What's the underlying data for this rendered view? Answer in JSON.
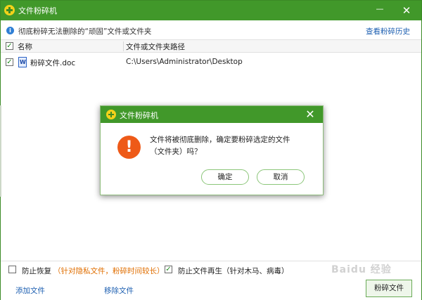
{
  "window": {
    "title": "文件粉碎机",
    "minimize_symbol": "—",
    "close_symbol": "✕"
  },
  "info": {
    "text": "彻底粉碎无法删除的“顽固”文件或文件夹",
    "history_link": "查看粉碎历史"
  },
  "table": {
    "col_name": "名称",
    "col_path": "文件或文件夹路径",
    "rows": [
      {
        "name": "粉碎文件.doc",
        "path": "C:\\Users\\Administrator\\Desktop",
        "checked": true
      }
    ]
  },
  "dialog": {
    "title": "文件粉碎机",
    "message_line1": "文件将被彻底删除，确定要粉碎选定的文件",
    "message_line2": "（文件夹）吗？",
    "confirm_label": "确定",
    "cancel_label": "取消"
  },
  "options": {
    "prevent_recovery_label": "防止恢复",
    "prevent_recovery_note": "（针对隐私文件，粉碎时间较长）",
    "prevent_recovery_checked": false,
    "prevent_regen_label": "防止文件再生（针对木马、病毒）",
    "prevent_regen_checked": true
  },
  "actions": {
    "add_file": "添加文件",
    "remove_file": "移除文件",
    "shred": "粉碎文件"
  },
  "colors": {
    "accent_green": "#41982a",
    "link_blue": "#1d5fb1",
    "warning_orange": "#ee5a18"
  },
  "icons": {
    "app_logo": "shredder-logo-icon",
    "info": "info-icon",
    "file": "word-doc-icon",
    "warning": "exclamation-icon",
    "close": "close-icon"
  },
  "watermark": "Baidu 经验"
}
